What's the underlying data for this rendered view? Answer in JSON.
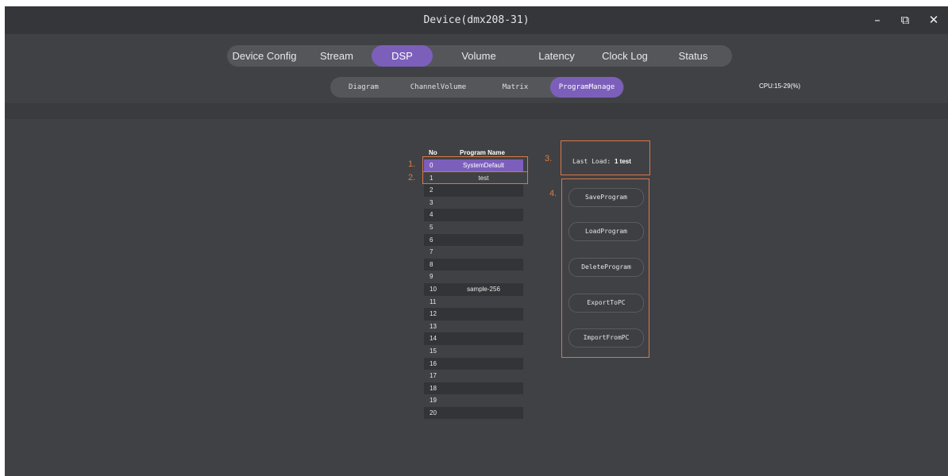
{
  "window": {
    "title": "Device(dmx208-31)",
    "minimize_glyph": "–",
    "restore_glyph": "⧉",
    "close_glyph": "✕"
  },
  "main_tabs": [
    {
      "label": "Device Config"
    },
    {
      "label": "Stream"
    },
    {
      "label": "DSP",
      "active": true
    },
    {
      "label": "Volume"
    },
    {
      "label": "Latency"
    },
    {
      "label": "Clock Log"
    },
    {
      "label": "Status"
    }
  ],
  "sub_tabs": [
    {
      "label": "Diagram"
    },
    {
      "label": "ChannelVolume"
    },
    {
      "label": "Matrix"
    },
    {
      "label": "ProgramManage",
      "active": true
    }
  ],
  "cpu": "CPU:15-29(%)",
  "program_list": {
    "col_no": "No",
    "col_name": "Program Name",
    "rows": [
      {
        "no": "0",
        "name": "SystemDefault"
      },
      {
        "no": "1",
        "name": "test"
      },
      {
        "no": "2",
        "name": ""
      },
      {
        "no": "3",
        "name": ""
      },
      {
        "no": "4",
        "name": ""
      },
      {
        "no": "5",
        "name": ""
      },
      {
        "no": "6",
        "name": ""
      },
      {
        "no": "7",
        "name": ""
      },
      {
        "no": "8",
        "name": ""
      },
      {
        "no": "9",
        "name": ""
      },
      {
        "no": "10",
        "name": "sample-256"
      },
      {
        "no": "11",
        "name": ""
      },
      {
        "no": "12",
        "name": ""
      },
      {
        "no": "13",
        "name": ""
      },
      {
        "no": "14",
        "name": ""
      },
      {
        "no": "15",
        "name": ""
      },
      {
        "no": "16",
        "name": ""
      },
      {
        "no": "17",
        "name": ""
      },
      {
        "no": "18",
        "name": ""
      },
      {
        "no": "19",
        "name": ""
      },
      {
        "no": "20",
        "name": ""
      }
    ]
  },
  "last_load": {
    "label": "Last Load:",
    "value": "1 test"
  },
  "actions": {
    "save": "SaveProgram",
    "load": "LoadProgram",
    "delete": "DeleteProgram",
    "export": "ExportToPC",
    "import": "ImportFromPC"
  },
  "annotations": {
    "a1": "1.",
    "a2": "2.",
    "a3": "3.",
    "a4": "4."
  },
  "colors": {
    "accent": "#7c5fbb",
    "callout": "#d9784a",
    "background": "#404144"
  }
}
